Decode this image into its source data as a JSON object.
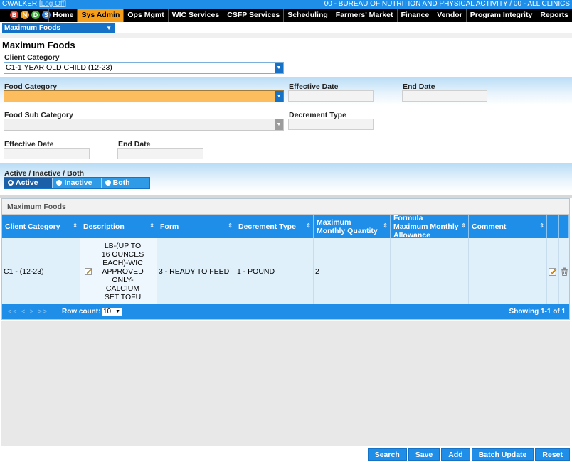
{
  "topbar": {
    "user": "CWALKER [",
    "logoff": "Log Off",
    "user_close": "]",
    "org": "00 - BUREAU OF NUTRITION AND PHYSICAL ACTIVITY / 00 - ALL CLINICS"
  },
  "logo": {
    "letters": [
      "B",
      "N",
      "D",
      "S"
    ],
    "colors": [
      "#e23b2e",
      "#f59e1b",
      "#3caa3c",
      "#2f7fd8"
    ]
  },
  "nav": [
    "Home",
    "Sys Admin",
    "Ops Mgmt",
    "WIC Services",
    "CSFP Services",
    "Scheduling",
    "Farmers' Market",
    "Finance",
    "Vendor",
    "Program Integrity",
    "Reports"
  ],
  "nav_active": "Sys Admin",
  "submenu": {
    "label": "Maximum Foods"
  },
  "page_title": "Maximum Foods",
  "form": {
    "client_category_label": "Client Category",
    "client_category_value": "C1-1 YEAR OLD CHILD (12-23)",
    "food_category_label": "Food Category",
    "food_category_value": "",
    "effective_date_label": "Effective Date",
    "end_date_label": "End Date",
    "food_sub_category_label": "Food Sub Category",
    "food_sub_category_value": "",
    "decrement_type_label": "Decrement Type",
    "effective_date2_label": "Effective Date",
    "end_date2_label": "End Date",
    "status_label": "Active / Inactive / Both",
    "status_options": [
      "Active",
      "Inactive",
      "Both"
    ],
    "status_selected": "Active"
  },
  "grid": {
    "title": "Maximum Foods",
    "headers": [
      "Client Category",
      "Description",
      "Form",
      "Decrement Type",
      "Maximum Monthly Quantity",
      "Formula Maximum Monthly Allowance",
      "Comment"
    ],
    "rows": [
      {
        "client_category": "C1 - (12-23)",
        "description": "LB-(UP TO 16 OUNCES EACH)-WIC APPROVED ONLY-CALCIUM SET TOFU",
        "form": "3 - READY TO FEED",
        "decrement_type": "1 - POUND",
        "max_monthly_qty": "2",
        "formula_max": "",
        "comment": ""
      }
    ],
    "pager": "<<  <  >  >>",
    "row_count_label": "Row count:",
    "row_count_value": "10",
    "showing": "Showing 1-1 of 1"
  },
  "buttons": [
    "Search",
    "Save",
    "Add",
    "Batch Update",
    "Reset"
  ]
}
